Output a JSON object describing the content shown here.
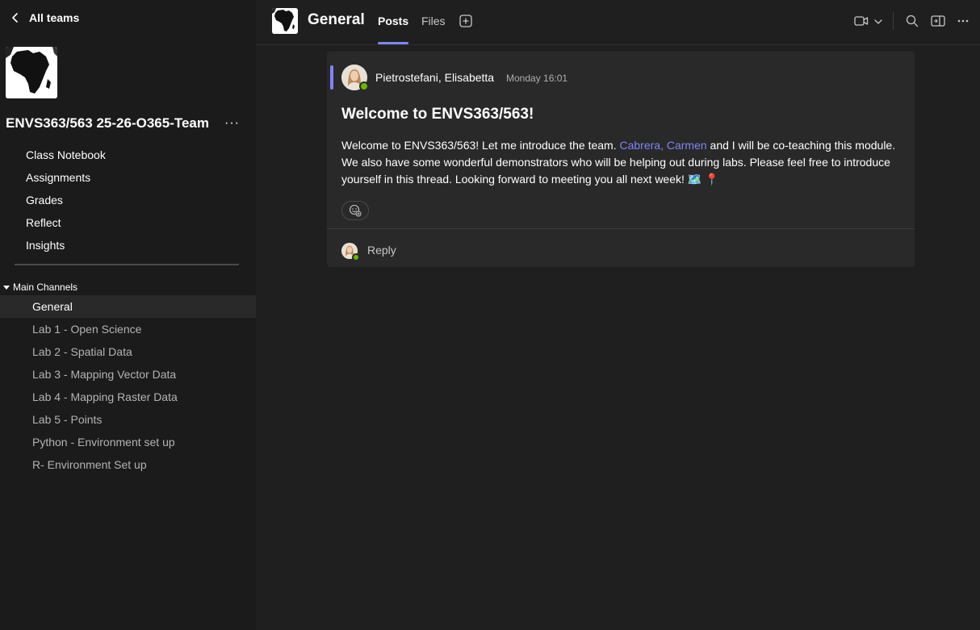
{
  "nav": {
    "back_label": "All teams"
  },
  "team": {
    "name": "ENVS363/563 25-26-O365-Team",
    "more_label": "···"
  },
  "apps": [
    {
      "label": "Class Notebook"
    },
    {
      "label": "Assignments"
    },
    {
      "label": "Grades"
    },
    {
      "label": "Reflect"
    },
    {
      "label": "Insights"
    }
  ],
  "channels": {
    "header": "Main Channels",
    "items": [
      {
        "label": "General",
        "active": true
      },
      {
        "label": "Lab 1 - Open Science"
      },
      {
        "label": "Lab 2 - Spatial Data"
      },
      {
        "label": "Lab 3 - Mapping Vector Data"
      },
      {
        "label": "Lab 4 - Mapping Raster Data"
      },
      {
        "label": "Lab 5 - Points"
      },
      {
        "label": "Python - Environment set up"
      },
      {
        "label": "R- Environment Set up"
      }
    ]
  },
  "header": {
    "channel_title": "General",
    "tabs": [
      {
        "label": "Posts",
        "active": true
      },
      {
        "label": "Files"
      }
    ],
    "icons": [
      "add-tab-icon",
      "video-camera-icon",
      "chevron-down-icon",
      "search-icon",
      "side-panel-icon",
      "more-icon"
    ]
  },
  "post": {
    "author": "Pietrostefani, Elisabetta",
    "timestamp": "Monday 16:01",
    "subject": "Welcome to ENVS363/563!",
    "body_before": "Welcome to ENVS363/563! Let me introduce the team. ",
    "mention": "Cabrera, Carmen",
    "body_after": " and I will be co-teaching this module. We also have some wonderful demonstrators who will be helping out during labs. Please feel free to introduce yourself in this thread. Looking forward to meeting you all next week! 🗺️ 📍",
    "reply_label": "Reply"
  },
  "colors": {
    "accent": "#7f85f5",
    "presence": "#6bb700",
    "background": "#1f1f1f",
    "sidebar": "#1b1b1b",
    "card": "#292929"
  }
}
